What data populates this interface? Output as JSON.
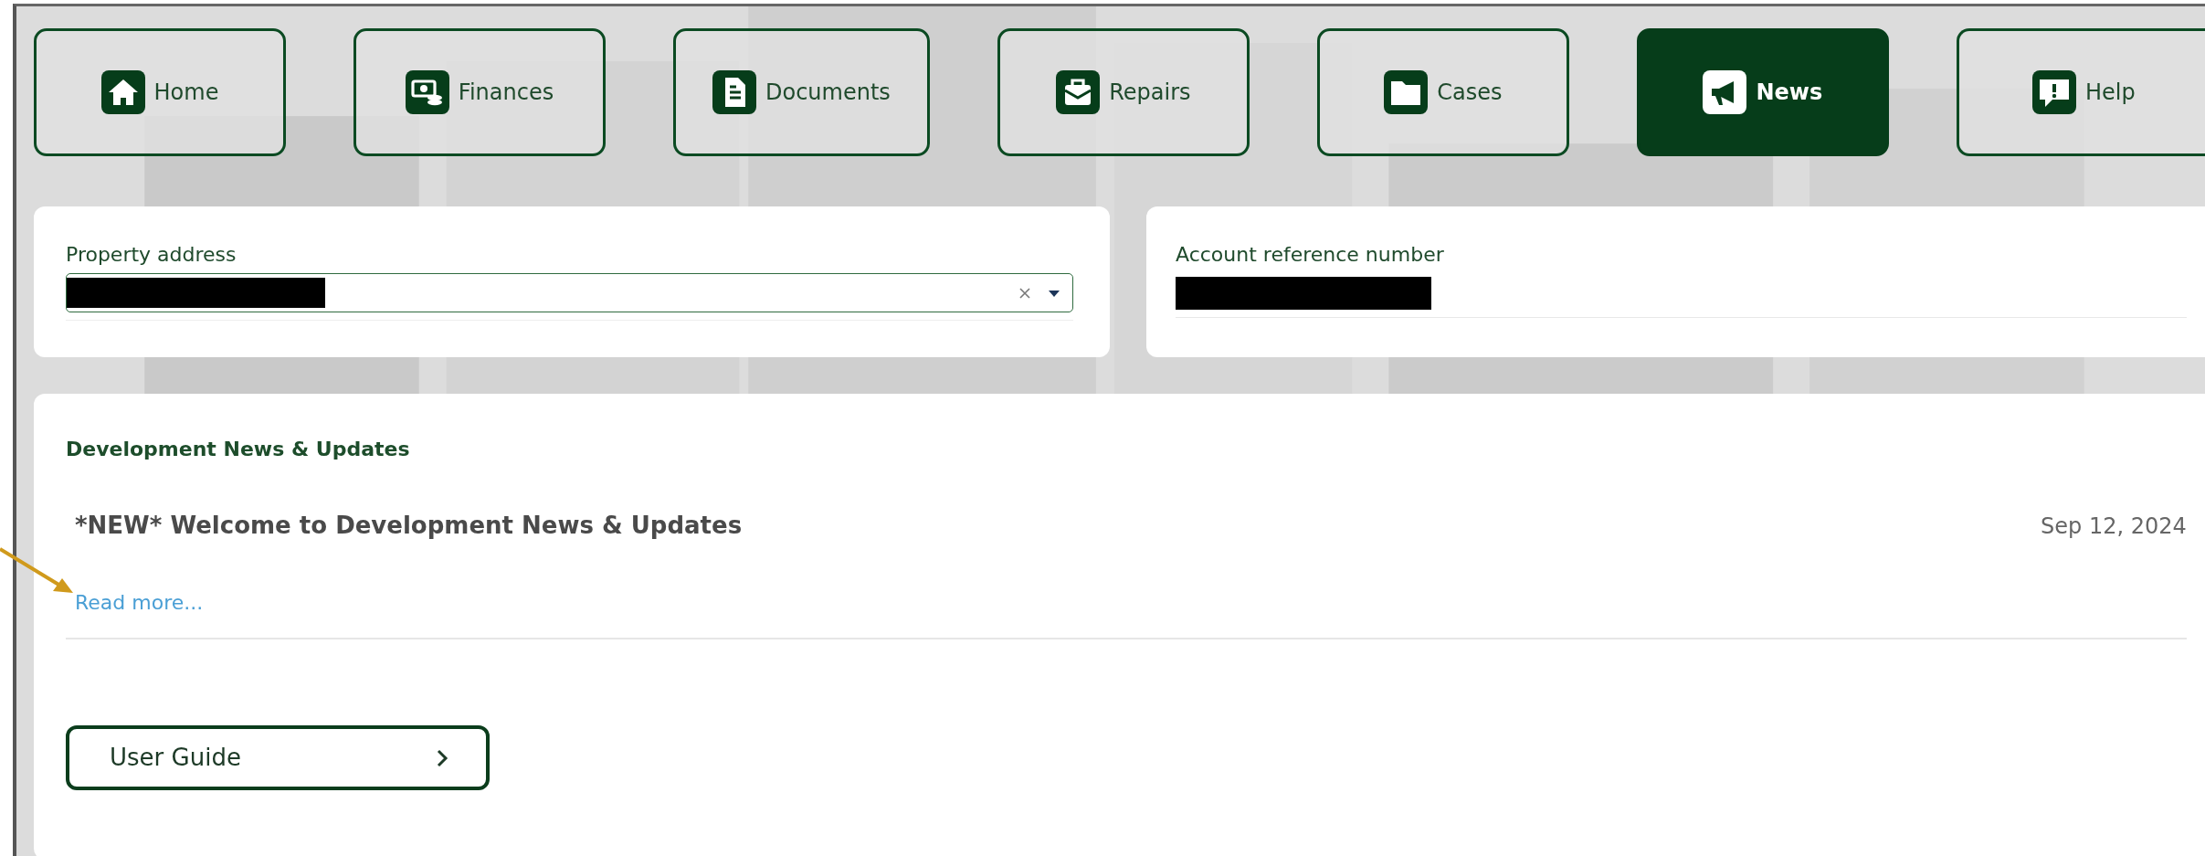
{
  "nav": [
    {
      "label": "Home",
      "kind": "home",
      "selected": false
    },
    {
      "label": "Finances",
      "kind": "finances",
      "selected": false
    },
    {
      "label": "Documents",
      "kind": "documents",
      "selected": false
    },
    {
      "label": "Repairs",
      "kind": "repairs",
      "selected": false
    },
    {
      "label": "Cases",
      "kind": "cases",
      "selected": false
    },
    {
      "label": "News",
      "kind": "news",
      "selected": true
    },
    {
      "label": "Help",
      "kind": "help",
      "selected": false
    }
  ],
  "property": {
    "label": "Property address"
  },
  "account": {
    "label": "Account reference number"
  },
  "news": {
    "heading": "Development News & Updates",
    "items": [
      {
        "title": "*NEW* Welcome to Development News & Updates",
        "date": "Sep 12, 2024",
        "link": "Read more..."
      }
    ]
  },
  "user_guide": {
    "label": "User Guide"
  }
}
